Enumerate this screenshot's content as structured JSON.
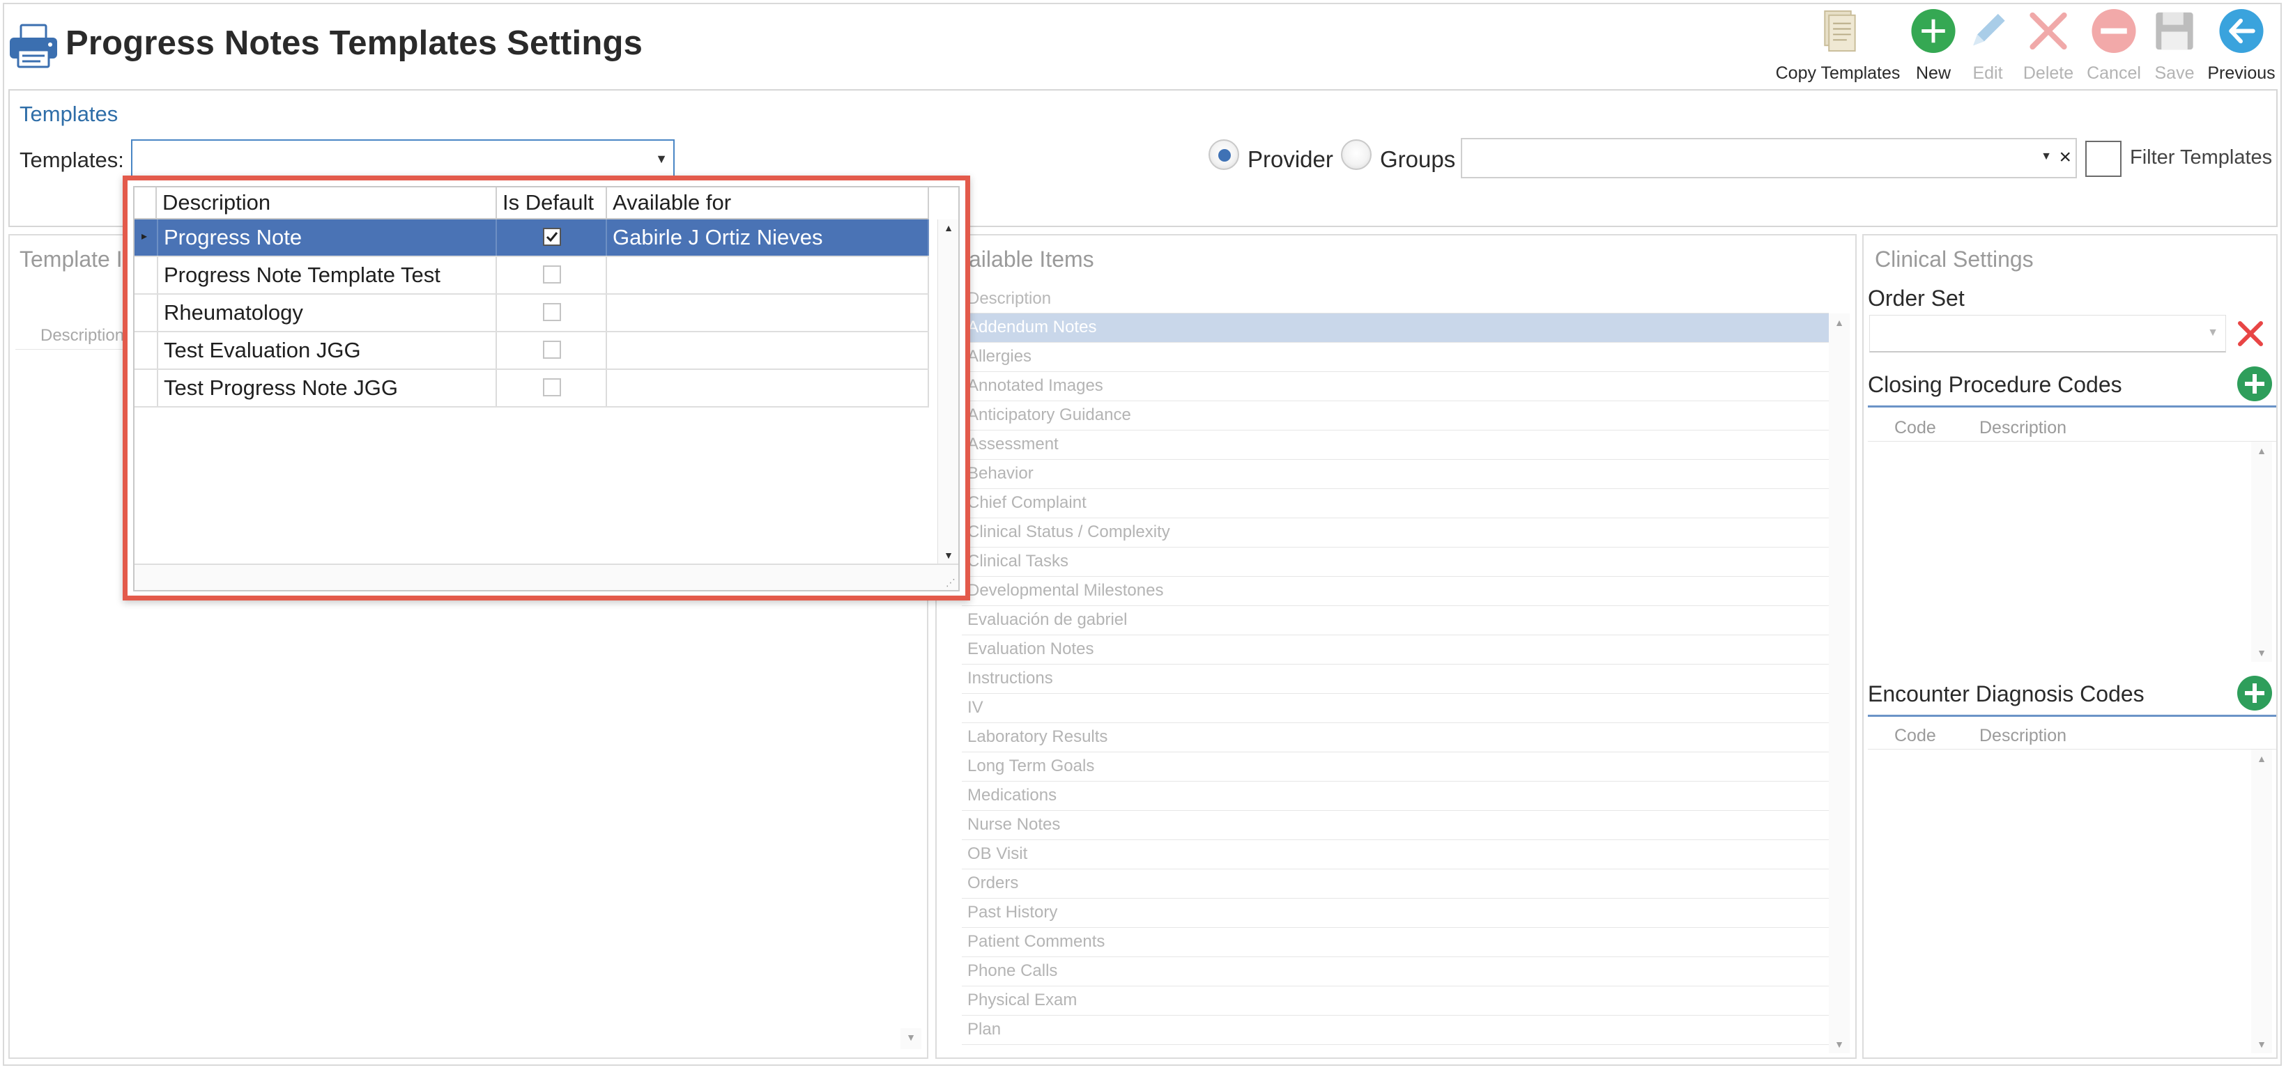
{
  "header": {
    "title": "Progress Notes Templates Settings"
  },
  "toolbar": {
    "copy_templates": "Copy Templates",
    "new": "New",
    "edit": "Edit",
    "delete": "Delete",
    "cancel": "Cancel",
    "save": "Save",
    "previous": "Previous"
  },
  "templates_section": {
    "heading": "Templates",
    "label": "Templates:",
    "provider_label": "Provider",
    "groups_label": "Groups",
    "filter_label": "Filter Templates"
  },
  "template_panel": {
    "title": "Template I",
    "column": "Description"
  },
  "available_items": {
    "title": "vailable Items",
    "column": "Description",
    "items": [
      "Addendum Notes",
      "Allergies",
      "Annotated Images",
      "Anticipatory Guidance",
      "Assessment",
      "Behavior",
      "Chief Complaint",
      "Clinical Status / Complexity",
      "Clinical Tasks",
      "Developmental Milestones",
      "Evaluación de gabriel",
      "Evaluation Notes",
      "Instructions",
      "IV",
      "Laboratory Results",
      "Long Term Goals",
      "Medications",
      "Nurse Notes",
      "OB Visit",
      "Orders",
      "Past History",
      "Patient Comments",
      "Phone Calls",
      "Physical Exam",
      "Plan"
    ]
  },
  "clinical_settings": {
    "title": "Clinical Settings",
    "order_set": "Order Set",
    "closing_codes": "Closing Procedure Codes",
    "encounter_codes": "Encounter Diagnosis Codes",
    "code_col": "Code",
    "desc_col": "Description"
  },
  "dropdown": {
    "columns": [
      "Description",
      "Is Default",
      "Available for"
    ],
    "rows": [
      {
        "description": "Progress Note",
        "is_default": true,
        "available_for": "Gabirle J Ortiz Nieves"
      },
      {
        "description": "Progress Note Template Test",
        "is_default": false,
        "available_for": ""
      },
      {
        "description": "Rheumatology",
        "is_default": false,
        "available_for": ""
      },
      {
        "description": "Test Evaluation JGG",
        "is_default": false,
        "available_for": ""
      },
      {
        "description": "Test Progress Note JGG",
        "is_default": false,
        "available_for": ""
      }
    ]
  },
  "colors": {
    "accent": "#4a73b5",
    "popup_border": "#e35a4b",
    "add_green": "#2e9e5b",
    "delete_red": "#e84545"
  }
}
